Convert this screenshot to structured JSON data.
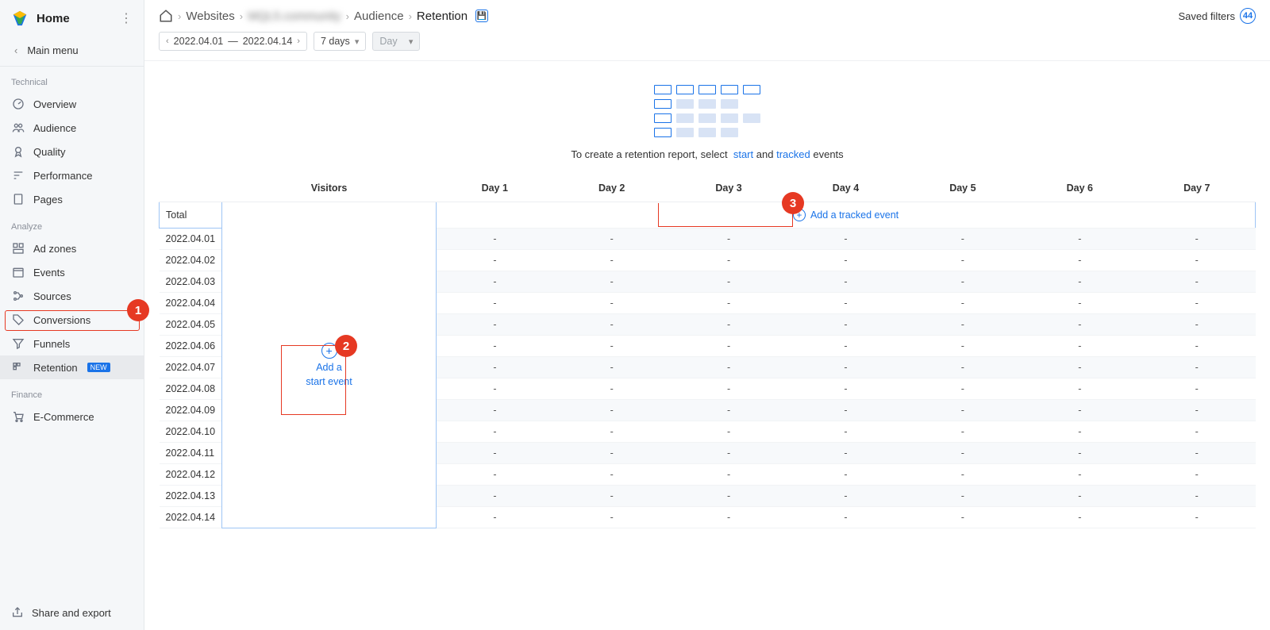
{
  "sidebar": {
    "title": "Home",
    "main_menu": "Main menu",
    "sections": {
      "technical": {
        "label": "Technical",
        "items": [
          {
            "label": "Overview"
          },
          {
            "label": "Audience"
          },
          {
            "label": "Quality"
          },
          {
            "label": "Performance"
          },
          {
            "label": "Pages"
          }
        ]
      },
      "analyze": {
        "label": "Analyze",
        "items": [
          {
            "label": "Ad zones"
          },
          {
            "label": "Events"
          },
          {
            "label": "Sources"
          },
          {
            "label": "Conversions"
          },
          {
            "label": "Funnels"
          },
          {
            "label": "Retention",
            "badge": "NEW"
          }
        ]
      },
      "finance": {
        "label": "Finance",
        "items": [
          {
            "label": "E-Commerce"
          }
        ]
      }
    },
    "share": "Share and export"
  },
  "breadcrumb": {
    "websites": "Websites",
    "site": "MQL5.community",
    "audience": "Audience",
    "retention": "Retention"
  },
  "saved_filters": {
    "label": "Saved filters",
    "count": "44"
  },
  "controls": {
    "date_start": "2022.04.01",
    "date_sep": "—",
    "date_end": "2022.04.14",
    "range": "7 days",
    "granularity": "Day"
  },
  "empty": {
    "prefix": "To create a retention report, select",
    "start_link": "start",
    "mid": "and",
    "tracked_link": "tracked",
    "suffix": "events"
  },
  "table": {
    "columns": [
      "",
      "Visitors",
      "Day 1",
      "Day 2",
      "Day 3",
      "Day 4",
      "Day 5",
      "Day 6",
      "Day 7"
    ],
    "total_label": "Total",
    "add_start": {
      "line1": "Add a",
      "line2": "start event"
    },
    "add_tracked": "Add a tracked event",
    "rows": [
      "2022.04.01",
      "2022.04.02",
      "2022.04.03",
      "2022.04.04",
      "2022.04.05",
      "2022.04.06",
      "2022.04.07",
      "2022.04.08",
      "2022.04.09",
      "2022.04.10",
      "2022.04.11",
      "2022.04.12",
      "2022.04.13",
      "2022.04.14"
    ],
    "dash": "-"
  },
  "callouts": {
    "c1": "1",
    "c2": "2",
    "c3": "3"
  }
}
